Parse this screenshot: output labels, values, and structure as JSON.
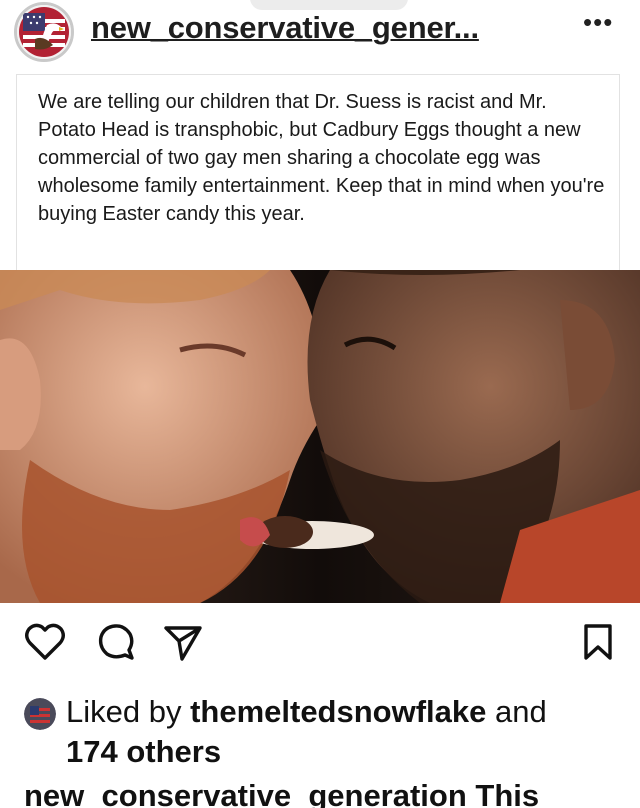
{
  "post": {
    "username": "new_conservative_gener...",
    "more_icon": "more-horizontal-icon",
    "caption": "We are telling our children that Dr. Suess is racist and Mr. Potato Head is transphobic, but Cadbury Eggs thought a new commercial of two gay men sharing a chocolate egg was wholesome family entertainment. Keep that in mind when you're buying Easter candy this year."
  },
  "actions": {
    "like_icon": "heart-icon",
    "comment_icon": "comment-icon",
    "share_icon": "send-icon",
    "save_icon": "bookmark-icon"
  },
  "likes": {
    "prefix": "Liked by ",
    "user": "themeltedsnowflake",
    "middle": " and",
    "others": "174 others"
  },
  "caption_footer": {
    "text": "new_conservative_generation This"
  },
  "colors": {
    "text": "#111111",
    "border": "#e2e2e2",
    "avatar_ring": "#c9c9c9"
  }
}
